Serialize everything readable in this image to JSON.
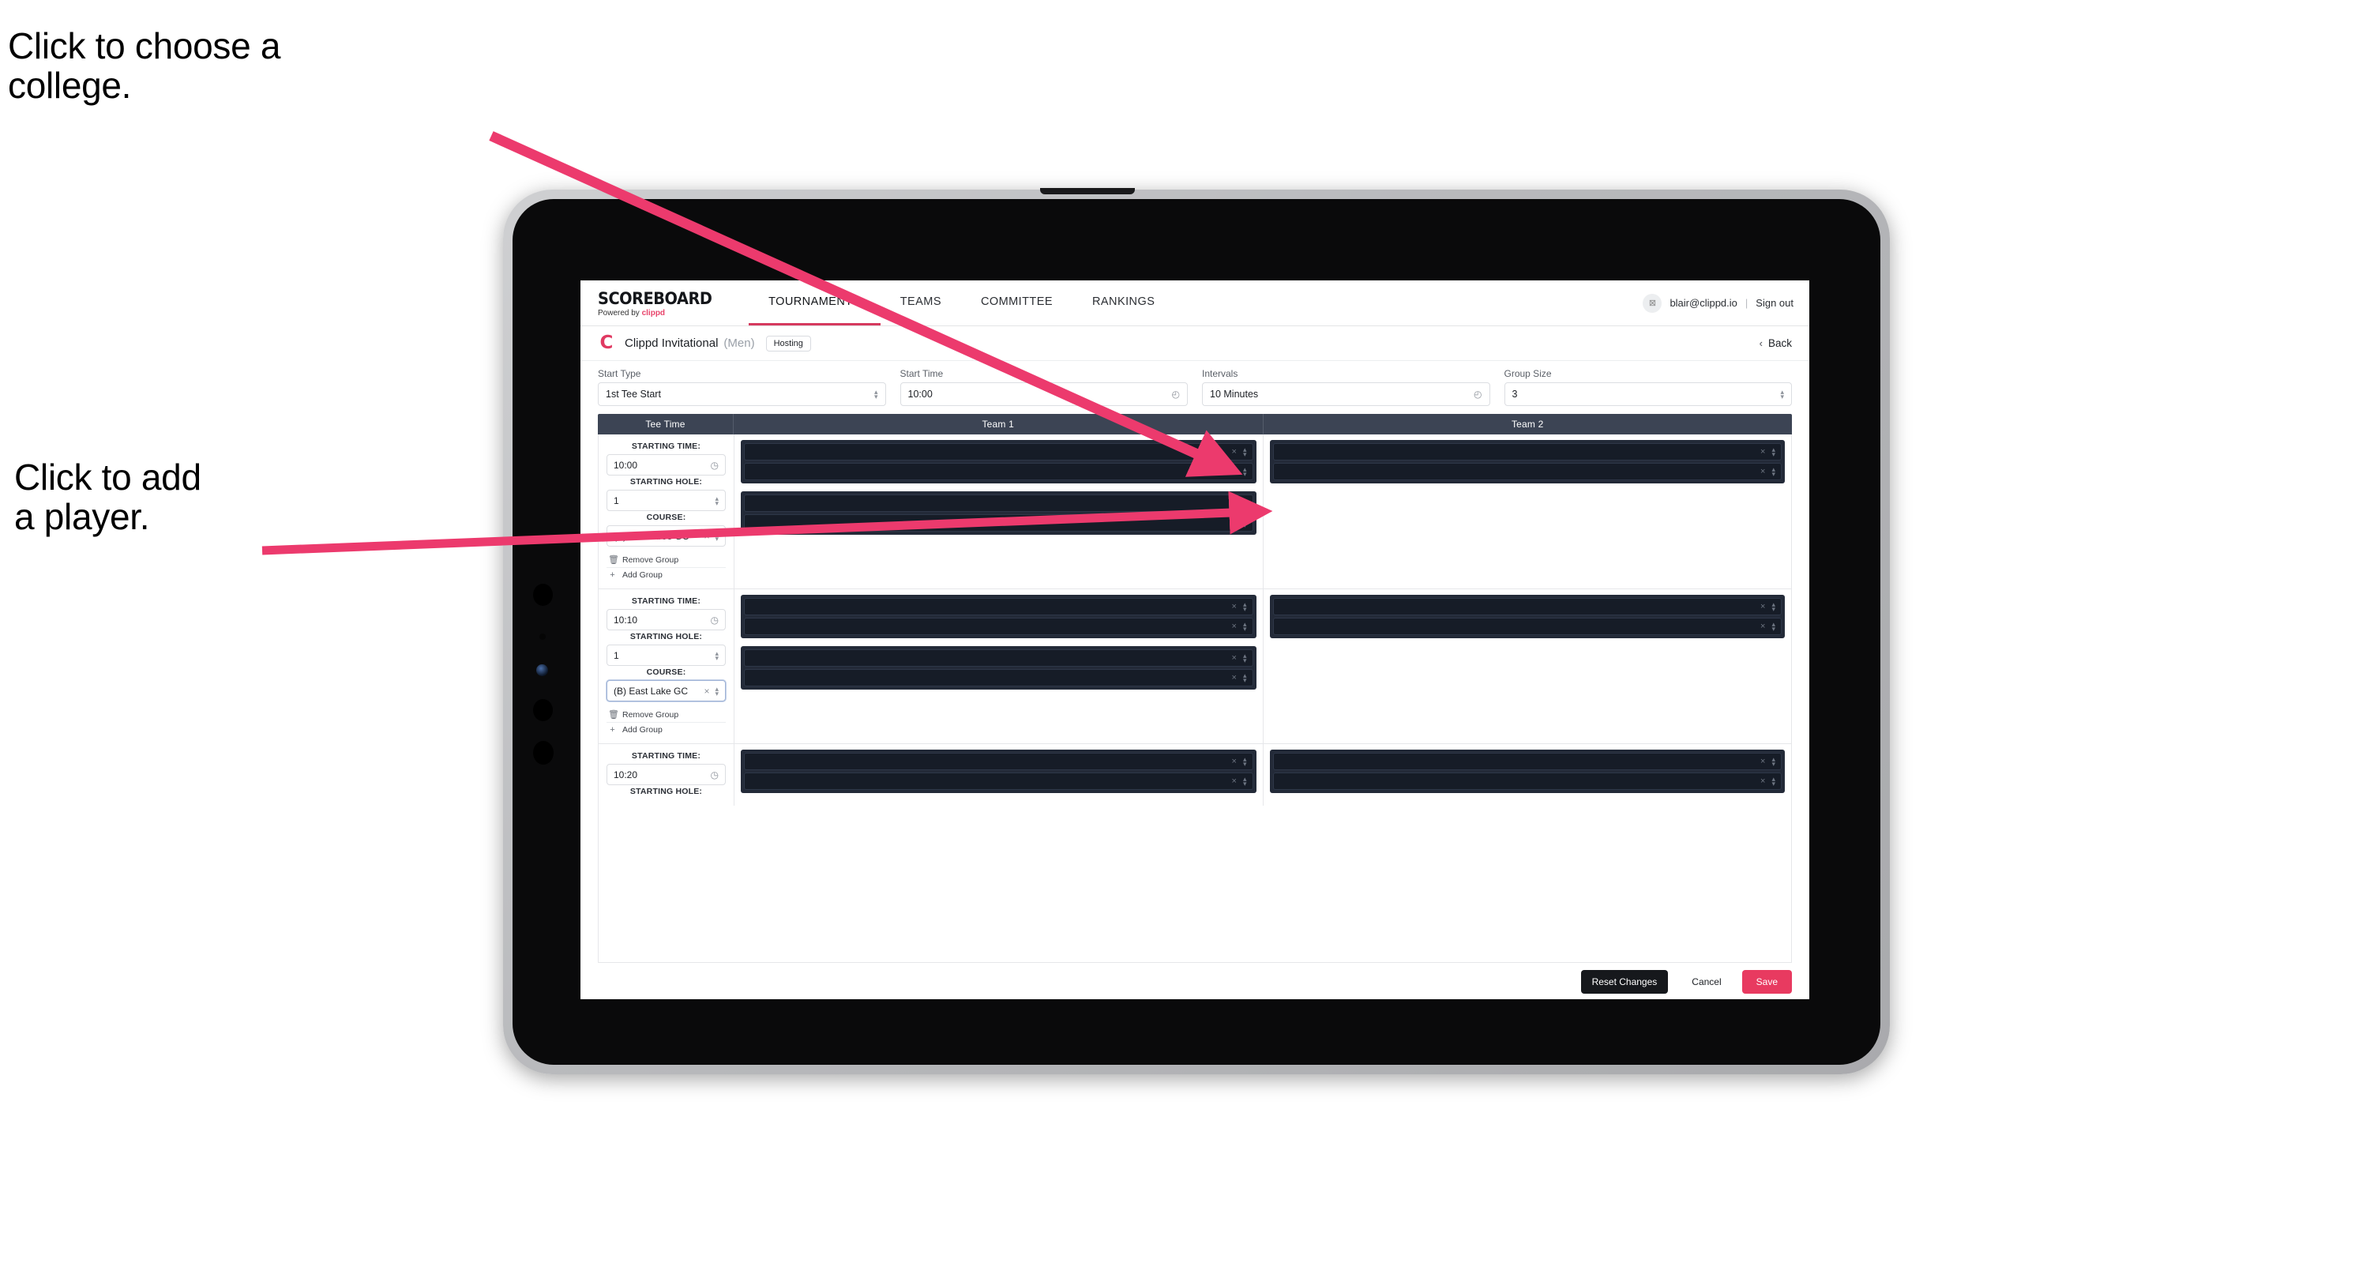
{
  "annotations": [
    {
      "id": "college",
      "text": "Click to choose a\ncollege."
    },
    {
      "id": "player",
      "text": "Click to add\na player."
    }
  ],
  "colors": {
    "accent_pink": "#e83a60",
    "nav_active_underline": "#d63a5e",
    "table_header_bg": "#3c4454",
    "player_slot_bg": "#161c27",
    "group_box_bg": "#232a38",
    "dark_button": "#16181c"
  },
  "navbar": {
    "brand_main": "SCOREBOARD",
    "brand_sub_prefix": "Powered by ",
    "brand_sub_name": "clippd",
    "tabs": [
      {
        "label": "TOURNAMENTS",
        "active": true
      },
      {
        "label": "TEAMS",
        "active": false
      },
      {
        "label": "COMMITTEE",
        "active": false
      },
      {
        "label": "RANKINGS",
        "active": false
      }
    ],
    "account_email": "blair@clippd.io",
    "separator": "|",
    "sign_out": "Sign out",
    "avatar_glyph": "⊠"
  },
  "tournament_header": {
    "logo_glyph": "C",
    "name": "Clippd Invitational",
    "gender": "(Men)",
    "badge": "Hosting",
    "back_chevron": "‹",
    "back_label": "Back"
  },
  "controls": [
    {
      "label": "Start Type",
      "value": "1st Tee Start",
      "icon": "stepper-icon"
    },
    {
      "label": "Start Time",
      "value": "10:00",
      "icon": "clock-icon"
    },
    {
      "label": "Intervals",
      "value": "10 Minutes",
      "icon": "clock-icon"
    },
    {
      "label": "Group Size",
      "value": "3",
      "icon": "stepper-icon"
    }
  ],
  "table": {
    "headers": {
      "tee_time": "Tee Time",
      "team1": "Team 1",
      "team2": "Team 2"
    },
    "field_labels": {
      "starting_time": "STARTING TIME:",
      "starting_hole": "STARTING HOLE:",
      "course": "COURSE:"
    },
    "group_actions": {
      "remove": "Remove Group",
      "add": "Add Group"
    },
    "icons": {
      "remove": "trash-icon",
      "add": "plus-icon",
      "clear": "×",
      "stepper": "stepper-icon",
      "clock": "clock-icon"
    },
    "rows": [
      {
        "starting_time": "10:00",
        "starting_hole": "1",
        "course": "(A) Peachtree GC",
        "course_focused": false,
        "team1_groups": [
          {
            "players": [
              "",
              ""
            ]
          },
          {
            "players": [
              "",
              ""
            ]
          }
        ],
        "team2_groups": [
          {
            "players": [
              "",
              ""
            ]
          }
        ]
      },
      {
        "starting_time": "10:10",
        "starting_hole": "1",
        "course": "(B) East Lake GC",
        "course_focused": true,
        "team1_groups": [
          {
            "players": [
              "",
              ""
            ]
          },
          {
            "players": [
              "",
              ""
            ]
          }
        ],
        "team2_groups": [
          {
            "players": [
              "",
              ""
            ]
          }
        ]
      },
      {
        "starting_time": "10:20",
        "starting_hole": "",
        "course": "",
        "course_focused": false,
        "team1_groups": [
          {
            "players": [
              "",
              ""
            ]
          }
        ],
        "team2_groups": [
          {
            "players": [
              "",
              ""
            ]
          }
        ]
      }
    ]
  },
  "footer": {
    "reset": "Reset Changes",
    "cancel": "Cancel",
    "save": "Save"
  }
}
